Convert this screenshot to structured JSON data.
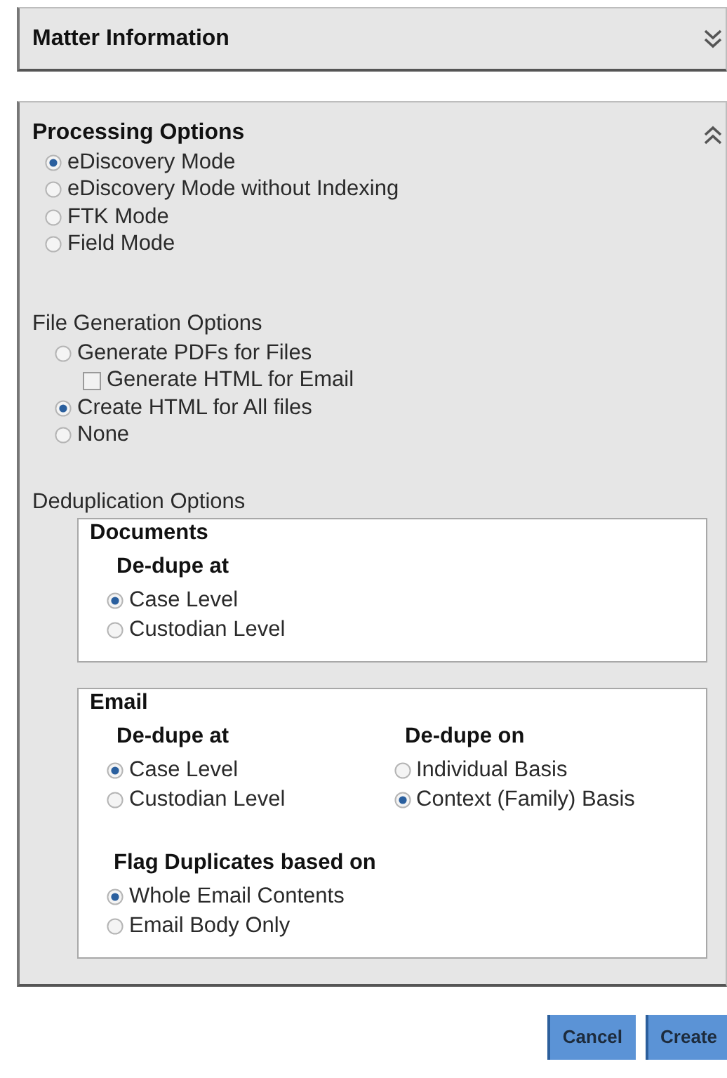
{
  "matter_panel": {
    "title": "Matter Information",
    "expanded": false
  },
  "processing_panel": {
    "title": "Processing Options",
    "expanded": true,
    "modes": [
      {
        "label": "eDiscovery Mode",
        "selected": true
      },
      {
        "label": "eDiscovery Mode without Indexing",
        "selected": false
      },
      {
        "label": "FTK Mode",
        "selected": false
      },
      {
        "label": "Field Mode",
        "selected": false
      }
    ],
    "file_generation": {
      "label": "File Generation Options",
      "options": [
        {
          "label": "Generate PDFs for Files",
          "selected": false,
          "children": [
            {
              "label": "Generate HTML for Email",
              "checked": false
            }
          ]
        },
        {
          "label": "Create HTML for All files",
          "selected": true
        },
        {
          "label": "None",
          "selected": false
        }
      ]
    },
    "deduplication": {
      "label": "Deduplication Options",
      "boxes": [
        {
          "title": "Documents",
          "rows": [
            [
              {
                "heading": "De-dupe at",
                "options": [
                  {
                    "label": "Case Level",
                    "selected": true
                  },
                  {
                    "label": "Custodian Level",
                    "selected": false
                  }
                ]
              }
            ]
          ]
        },
        {
          "title": "Email",
          "rows": [
            [
              {
                "heading": "De-dupe at",
                "options": [
                  {
                    "label": "Case Level",
                    "selected": true
                  },
                  {
                    "label": "Custodian Level",
                    "selected": false
                  }
                ]
              },
              {
                "heading": "De-dupe on",
                "options": [
                  {
                    "label": "Individual Basis",
                    "selected": false
                  },
                  {
                    "label": "Context (Family) Basis",
                    "selected": true
                  }
                ]
              }
            ],
            [
              {
                "heading": "Flag Duplicates based on",
                "options": [
                  {
                    "label": "Whole Email Contents",
                    "selected": true
                  },
                  {
                    "label": "Email Body Only",
                    "selected": false
                  }
                ]
              }
            ]
          ]
        }
      ]
    }
  },
  "buttons": [
    "Cancel",
    "Create"
  ]
}
